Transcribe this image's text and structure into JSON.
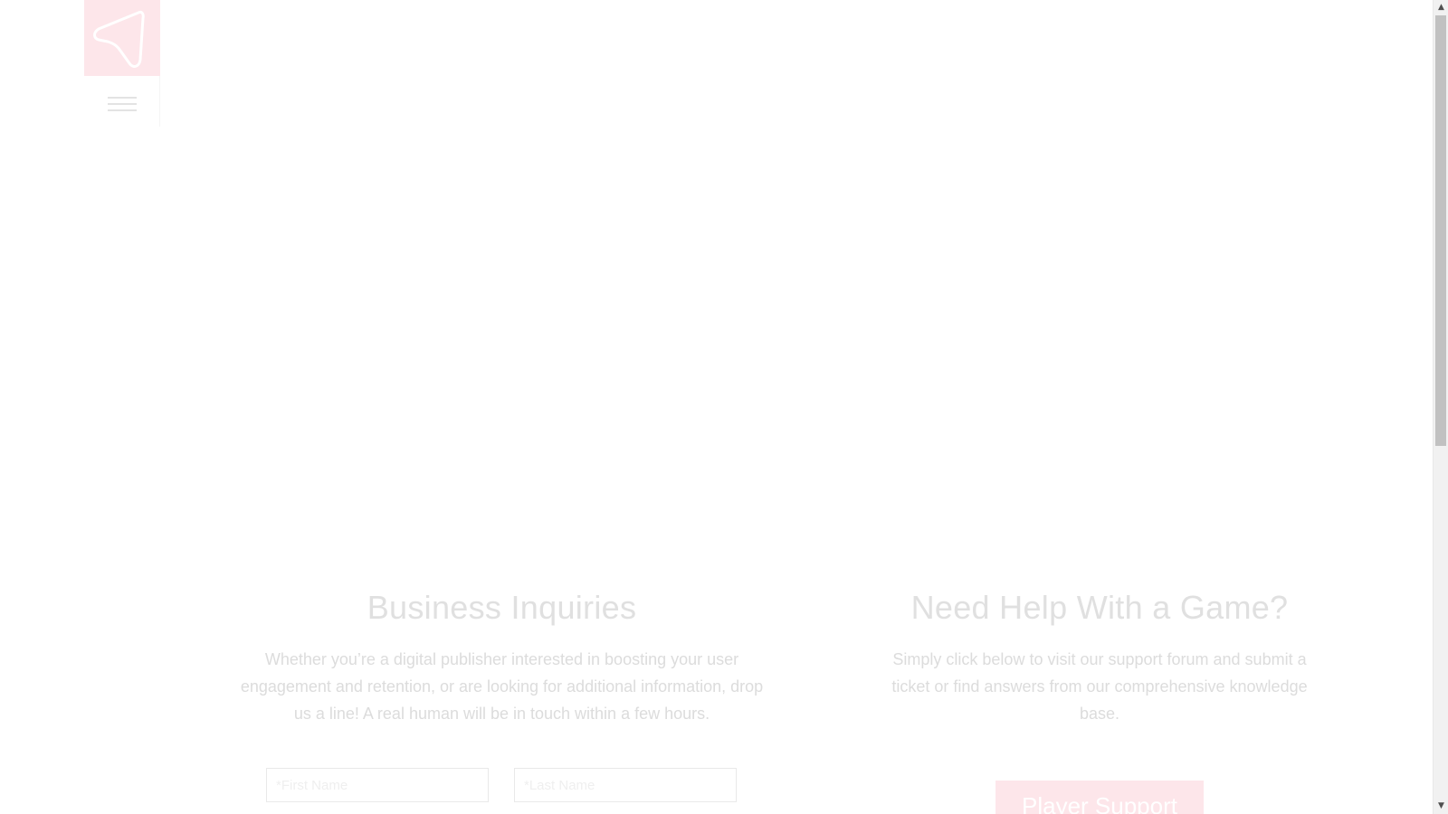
{
  "nav": {
    "logo_icon": "triangle-loop-logo",
    "menu_icon": "hamburger-menu-icon"
  },
  "business": {
    "heading": "Business Inquiries",
    "description": "Whether you’re a digital publisher interested in boosting your user engagement and retention, or are looking for additional information, drop us a line! A real human will be in touch within a few hours.",
    "first_name_placeholder": "*First Name",
    "last_name_placeholder": "*Last Name"
  },
  "support": {
    "heading": "Need Help With a Game?",
    "description": "Simply click below to visit our support forum and submit a ticket or find answers from our comprehensive knowledge base.",
    "button_label": "Player Support"
  },
  "scrollbar": {
    "up_icon": "▲",
    "down_icon": "▼"
  },
  "colors": {
    "accent": "#fde6ea",
    "heading_text": "#e0e0e0",
    "body_text": "#dcdcdc"
  }
}
